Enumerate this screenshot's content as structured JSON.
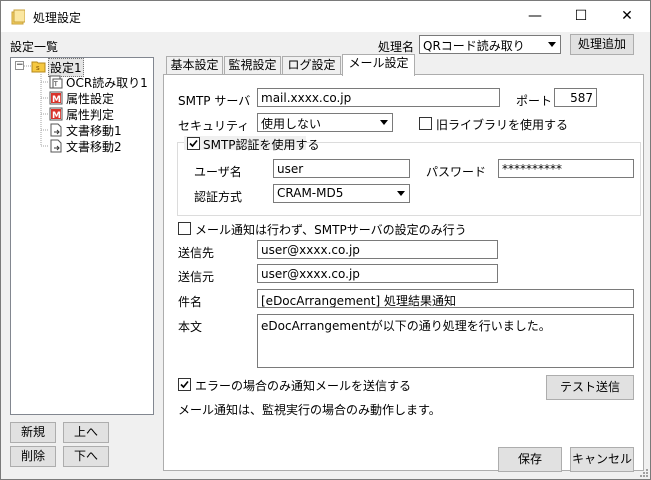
{
  "window": {
    "title": "処理設定",
    "minimize": "—",
    "maximize": "☐",
    "close": "✕"
  },
  "left": {
    "title": "設定一覧"
  },
  "tree": {
    "expander": "−",
    "root": "設定1",
    "children": [
      "OCR読み取り1",
      "属性設定",
      "属性判定",
      "文書移動1",
      "文書移動2"
    ]
  },
  "top": {
    "process_label": "処理名",
    "process_value": "QRコード読み取り",
    "add_button": "処理追加"
  },
  "tabs": [
    "基本設定",
    "監視設定",
    "ログ設定",
    "メール設定"
  ],
  "active_tab": 3,
  "mail": {
    "smtp_label": "SMTP サーバ",
    "smtp_value": "mail.xxxx.co.jp",
    "port_label": "ポート",
    "port_value": "587",
    "security_label": "セキュリティ",
    "security_value": "使用しない",
    "old_lib_label": "旧ライブラリを使用する",
    "old_lib_checked": false,
    "auth_label": "SMTP認証を使用する",
    "auth_checked": true,
    "user_label": "ユーザ名",
    "user_value": "user",
    "password_label": "パスワード",
    "password_value": "**********",
    "auth_method_label": "認証方式",
    "auth_method_value": "CRAM-MD5",
    "smtp_only_label": "メール通知は行わず、SMTPサーバの設定のみ行う",
    "smtp_only_checked": false,
    "to_label": "送信先",
    "to_value": "user@xxxx.co.jp",
    "from_label": "送信元",
    "from_value": "user@xxxx.co.jp",
    "subject_label": "件名",
    "subject_value": "[eDocArrangement] 処理結果通知",
    "body_label": "本文",
    "body_value": "eDocArrangementが以下の通り処理を行いました。",
    "error_only_label": "エラーの場合のみ通知メールを送信する",
    "error_only_checked": true,
    "test_button": "テスト送信",
    "note": "メール通知は、監視実行の場合のみ動作します。"
  },
  "buttons": {
    "new": "新規",
    "up": "上へ",
    "delete": "削除",
    "down": "下へ",
    "save": "保存",
    "cancel": "キャンセル"
  }
}
